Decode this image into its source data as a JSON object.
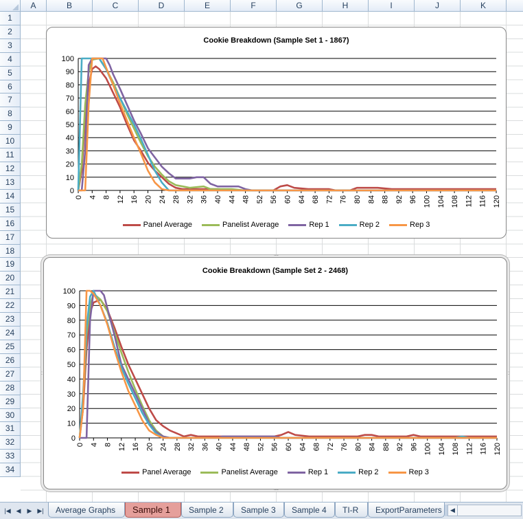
{
  "columns": [
    "A",
    "B",
    "C",
    "D",
    "E",
    "F",
    "G",
    "H",
    "I",
    "J",
    "K"
  ],
  "rows": [
    "1",
    "2",
    "3",
    "4",
    "5",
    "6",
    "7",
    "8",
    "9",
    "10",
    "11",
    "12",
    "13",
    "14",
    "15",
    "16",
    "17",
    "18",
    "19",
    "20",
    "21",
    "22",
    "23",
    "24",
    "25",
    "26",
    "27",
    "28",
    "29",
    "30",
    "31",
    "32",
    "33",
    "34"
  ],
  "sheet_tabs": [
    "Average Graphs",
    "Sample 1",
    "Sample 2",
    "Sample 3",
    "Sample 4",
    "TI-R",
    "ExportParameters"
  ],
  "active_tab": "Sample 1",
  "icons": {
    "first": "first-sheet-icon",
    "prev": "prev-sheet-icon",
    "next": "next-sheet-icon",
    "last": "last-sheet-icon"
  },
  "chart_data": [
    {
      "type": "line",
      "title": "Cookie Breakdown (Sample Set 1 - 1867)",
      "xlabel": "",
      "ylabel": "",
      "xlim": [
        0,
        120
      ],
      "ylim": [
        0,
        100
      ],
      "x_ticks": [
        0,
        4,
        8,
        12,
        16,
        20,
        24,
        28,
        32,
        36,
        40,
        44,
        48,
        52,
        56,
        60,
        64,
        68,
        72,
        76,
        80,
        84,
        88,
        92,
        96,
        100,
        104,
        108,
        112,
        116,
        120
      ],
      "y_ticks": [
        0,
        10,
        20,
        30,
        40,
        50,
        60,
        70,
        80,
        90,
        100
      ],
      "grid": true,
      "legend_position": "bottom",
      "series": [
        {
          "name": "Panel Average",
          "color": "#be4b48",
          "points": [
            [
              0,
              0
            ],
            [
              1,
              15
            ],
            [
              2,
              55
            ],
            [
              3,
              80
            ],
            [
              4,
              92
            ],
            [
              5,
              94
            ],
            [
              6,
              92
            ],
            [
              8,
              85
            ],
            [
              10,
              74
            ],
            [
              12,
              63
            ],
            [
              14,
              50
            ],
            [
              16,
              38
            ],
            [
              18,
              30
            ],
            [
              20,
              21
            ],
            [
              22,
              15
            ],
            [
              24,
              10
            ],
            [
              26,
              5
            ],
            [
              28,
              2
            ],
            [
              30,
              1
            ],
            [
              34,
              1
            ],
            [
              40,
              1
            ],
            [
              48,
              0
            ],
            [
              56,
              0
            ],
            [
              58,
              3
            ],
            [
              60,
              4
            ],
            [
              62,
              2
            ],
            [
              66,
              1
            ],
            [
              72,
              1
            ],
            [
              74,
              0
            ],
            [
              78,
              0
            ],
            [
              80,
              2
            ],
            [
              84,
              2
            ],
            [
              86,
              2
            ],
            [
              90,
              1
            ],
            [
              120,
              1
            ]
          ]
        },
        {
          "name": "Panelist Average",
          "color": "#9bbb59",
          "points": [
            [
              0,
              0
            ],
            [
              1,
              20
            ],
            [
              2,
              65
            ],
            [
              3,
              90
            ],
            [
              4,
              99
            ],
            [
              6,
              100
            ],
            [
              8,
              92
            ],
            [
              10,
              82
            ],
            [
              12,
              70
            ],
            [
              14,
              58
            ],
            [
              16,
              47
            ],
            [
              18,
              36
            ],
            [
              20,
              26
            ],
            [
              22,
              18
            ],
            [
              24,
              12
            ],
            [
              26,
              7
            ],
            [
              28,
              4
            ],
            [
              30,
              3
            ],
            [
              32,
              2
            ],
            [
              36,
              3
            ],
            [
              38,
              1
            ],
            [
              44,
              1
            ],
            [
              48,
              0
            ],
            [
              120,
              0
            ]
          ]
        },
        {
          "name": "Rep 1",
          "color": "#7f64a2",
          "points": [
            [
              0,
              0
            ],
            [
              1,
              0
            ],
            [
              2,
              30
            ],
            [
              3,
              95
            ],
            [
              4,
              100
            ],
            [
              8,
              100
            ],
            [
              9,
              95
            ],
            [
              10,
              88
            ],
            [
              12,
              77
            ],
            [
              14,
              65
            ],
            [
              16,
              53
            ],
            [
              18,
              43
            ],
            [
              20,
              32
            ],
            [
              22,
              25
            ],
            [
              24,
              18
            ],
            [
              26,
              13
            ],
            [
              28,
              9
            ],
            [
              32,
              9
            ],
            [
              34,
              10
            ],
            [
              36,
              10
            ],
            [
              38,
              5
            ],
            [
              40,
              3
            ],
            [
              46,
              3
            ],
            [
              48,
              1
            ],
            [
              50,
              0
            ],
            [
              120,
              0
            ]
          ]
        },
        {
          "name": "Rep 2",
          "color": "#4aacc5",
          "points": [
            [
              0,
              0
            ],
            [
              1,
              100
            ],
            [
              4,
              100
            ],
            [
              6,
              100
            ],
            [
              8,
              92
            ],
            [
              10,
              80
            ],
            [
              12,
              70
            ],
            [
              14,
              60
            ],
            [
              16,
              50
            ],
            [
              18,
              39
            ],
            [
              20,
              27
            ],
            [
              22,
              15
            ],
            [
              24,
              6
            ],
            [
              26,
              0
            ],
            [
              120,
              0
            ]
          ]
        },
        {
          "name": "Rep 3",
          "color": "#f79646",
          "points": [
            [
              0,
              0
            ],
            [
              2,
              0
            ],
            [
              3,
              65
            ],
            [
              4,
              100
            ],
            [
              7,
              100
            ],
            [
              8,
              93
            ],
            [
              10,
              80
            ],
            [
              12,
              66
            ],
            [
              14,
              53
            ],
            [
              16,
              40
            ],
            [
              18,
              28
            ],
            [
              20,
              15
            ],
            [
              22,
              6
            ],
            [
              24,
              1
            ],
            [
              26,
              0
            ],
            [
              120,
              0
            ]
          ]
        }
      ]
    },
    {
      "type": "line",
      "title": "Cookie Breakdown (Sample Set 2 - 2468)",
      "xlabel": "",
      "ylabel": "",
      "xlim": [
        0,
        120
      ],
      "ylim": [
        0,
        100
      ],
      "x_ticks": [
        0,
        4,
        8,
        12,
        16,
        20,
        24,
        28,
        32,
        36,
        40,
        44,
        48,
        52,
        56,
        60,
        64,
        68,
        72,
        76,
        80,
        84,
        88,
        92,
        96,
        100,
        104,
        108,
        112,
        116,
        120
      ],
      "y_ticks": [
        0,
        10,
        20,
        30,
        40,
        50,
        60,
        70,
        80,
        90,
        100
      ],
      "grid": true,
      "legend_position": "bottom",
      "series": [
        {
          "name": "Panel Average",
          "color": "#be4b48",
          "points": [
            [
              0,
              0
            ],
            [
              1,
              20
            ],
            [
              2,
              60
            ],
            [
              3,
              85
            ],
            [
              4,
              92
            ],
            [
              6,
              94
            ],
            [
              8,
              87
            ],
            [
              10,
              75
            ],
            [
              12,
              62
            ],
            [
              14,
              50
            ],
            [
              16,
              40
            ],
            [
              18,
              30
            ],
            [
              20,
              20
            ],
            [
              22,
              12
            ],
            [
              24,
              8
            ],
            [
              26,
              5
            ],
            [
              28,
              3
            ],
            [
              30,
              1
            ],
            [
              32,
              2
            ],
            [
              34,
              1
            ],
            [
              40,
              1
            ],
            [
              56,
              1
            ],
            [
              58,
              2
            ],
            [
              60,
              4
            ],
            [
              62,
              2
            ],
            [
              66,
              1
            ],
            [
              80,
              1
            ],
            [
              82,
              2
            ],
            [
              84,
              2
            ],
            [
              86,
              1
            ],
            [
              94,
              1
            ],
            [
              96,
              2
            ],
            [
              98,
              1
            ],
            [
              120,
              1
            ]
          ]
        },
        {
          "name": "Panelist Average",
          "color": "#9bbb59",
          "points": [
            [
              0,
              0
            ],
            [
              1,
              25
            ],
            [
              2,
              70
            ],
            [
              3,
              90
            ],
            [
              4,
              98
            ],
            [
              6,
              94
            ],
            [
              8,
              86
            ],
            [
              10,
              72
            ],
            [
              12,
              58
            ],
            [
              14,
              45
            ],
            [
              16,
              33
            ],
            [
              18,
              22
            ],
            [
              20,
              12
            ],
            [
              22,
              5
            ],
            [
              24,
              1
            ],
            [
              26,
              0
            ],
            [
              120,
              0
            ]
          ]
        },
        {
          "name": "Rep 1",
          "color": "#7f64a2",
          "points": [
            [
              0,
              0
            ],
            [
              2,
              0
            ],
            [
              3,
              80
            ],
            [
              4,
              100
            ],
            [
              6,
              100
            ],
            [
              7,
              97
            ],
            [
              8,
              88
            ],
            [
              10,
              70
            ],
            [
              12,
              50
            ],
            [
              14,
              40
            ],
            [
              16,
              30
            ],
            [
              18,
              20
            ],
            [
              20,
              10
            ],
            [
              22,
              4
            ],
            [
              24,
              1
            ],
            [
              26,
              0
            ],
            [
              40,
              0
            ],
            [
              41,
              1
            ],
            [
              56,
              1
            ],
            [
              58,
              0
            ],
            [
              120,
              0
            ]
          ]
        },
        {
          "name": "Rep 2",
          "color": "#4aacc5",
          "points": [
            [
              0,
              0
            ],
            [
              1,
              30
            ],
            [
              2,
              75
            ],
            [
              3,
              96
            ],
            [
              4,
              100
            ],
            [
              6,
              90
            ],
            [
              8,
              78
            ],
            [
              10,
              62
            ],
            [
              12,
              48
            ],
            [
              14,
              37
            ],
            [
              16,
              27
            ],
            [
              18,
              17
            ],
            [
              20,
              9
            ],
            [
              22,
              3
            ],
            [
              24,
              0
            ],
            [
              108,
              0
            ],
            [
              110,
              1
            ],
            [
              112,
              0
            ],
            [
              120,
              0
            ]
          ]
        },
        {
          "name": "Rep 3",
          "color": "#f79646",
          "points": [
            [
              0,
              0
            ],
            [
              1,
              20
            ],
            [
              2,
              100
            ],
            [
              3,
              100
            ],
            [
              4,
              98
            ],
            [
              6,
              90
            ],
            [
              8,
              77
            ],
            [
              10,
              60
            ],
            [
              12,
              45
            ],
            [
              14,
              32
            ],
            [
              16,
              22
            ],
            [
              18,
              12
            ],
            [
              20,
              5
            ],
            [
              22,
              2
            ],
            [
              24,
              0
            ],
            [
              120,
              0
            ]
          ]
        }
      ]
    }
  ]
}
